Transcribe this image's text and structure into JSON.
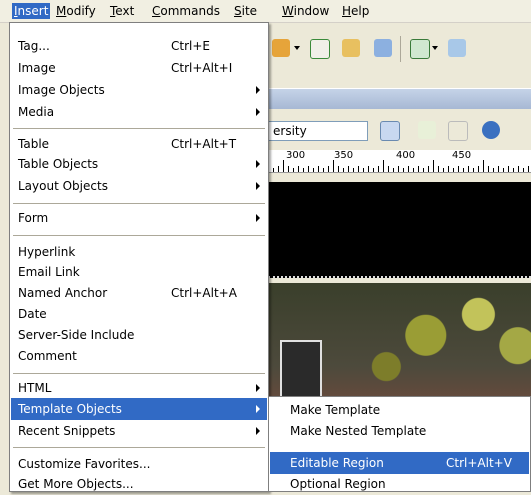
{
  "menubar": {
    "items": [
      {
        "label": "Insert",
        "accel": "I",
        "rest": "nsert"
      },
      {
        "label": "Modify",
        "accel": "M",
        "rest": "odify"
      },
      {
        "label": "Text",
        "accel": "T",
        "rest": "ext"
      },
      {
        "label": "Commands",
        "accel": "C",
        "rest": "ommands"
      },
      {
        "label": "Site",
        "accel": "S",
        "rest": "ite"
      },
      {
        "label": "Window",
        "accel": "W",
        "rest": "indow"
      },
      {
        "label": "Help",
        "accel": "H",
        "rest": "elp"
      }
    ]
  },
  "insert_menu": {
    "items": [
      {
        "label": "Tag...",
        "shortcut": "Ctrl+E",
        "submenu": false
      },
      {
        "label": "Image",
        "shortcut": "Ctrl+Alt+I",
        "submenu": false
      },
      {
        "label": "Image Objects",
        "shortcut": "",
        "submenu": true
      },
      {
        "label": "Media",
        "shortcut": "",
        "submenu": true
      },
      {
        "label": "Table",
        "shortcut": "Ctrl+Alt+T",
        "submenu": false
      },
      {
        "label": "Table Objects",
        "shortcut": "",
        "submenu": true
      },
      {
        "label": "Layout Objects",
        "shortcut": "",
        "submenu": true
      },
      {
        "label": "Form",
        "shortcut": "",
        "submenu": true
      },
      {
        "label": "Hyperlink",
        "shortcut": "",
        "submenu": false
      },
      {
        "label": "Email Link",
        "shortcut": "",
        "submenu": false
      },
      {
        "label": "Named Anchor",
        "shortcut": "Ctrl+Alt+A",
        "submenu": false
      },
      {
        "label": "Date",
        "shortcut": "",
        "submenu": false
      },
      {
        "label": "Server-Side Include",
        "shortcut": "",
        "submenu": false
      },
      {
        "label": "Comment",
        "shortcut": "",
        "submenu": false
      },
      {
        "label": "HTML",
        "shortcut": "",
        "submenu": true
      },
      {
        "label": "Template Objects",
        "shortcut": "",
        "submenu": true
      },
      {
        "label": "Recent Snippets",
        "shortcut": "",
        "submenu": true
      },
      {
        "label": "Customize Favorites...",
        "shortcut": "",
        "submenu": false
      },
      {
        "label": "Get More Objects...",
        "shortcut": "",
        "submenu": false
      }
    ]
  },
  "template_submenu": {
    "items": [
      {
        "label": "Make Template",
        "shortcut": ""
      },
      {
        "label": "Make Nested Template",
        "shortcut": ""
      },
      {
        "label": "Editable Region",
        "shortcut": "Ctrl+Alt+V"
      },
      {
        "label": "Optional Region",
        "shortcut": ""
      }
    ]
  },
  "document": {
    "title_field_value": "ersity",
    "ruler_labels": [
      "300",
      "350",
      "400",
      "450"
    ]
  },
  "colors": {
    "highlight": "#316ac5",
    "menu_bg": "#ffffff",
    "chrome": "#ece9d8"
  }
}
